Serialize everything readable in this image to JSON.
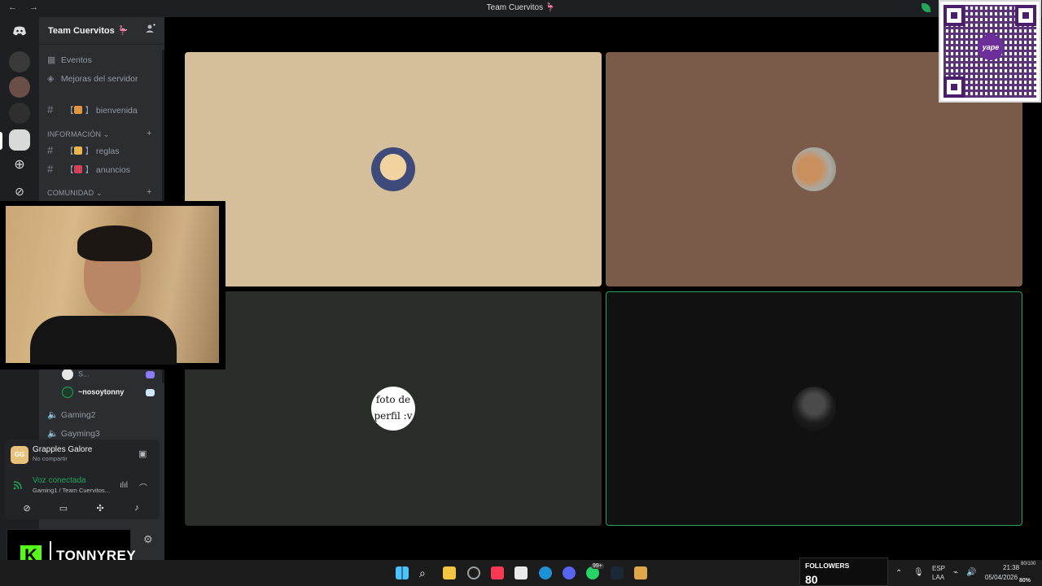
{
  "window": {
    "title": "Team Cuervitos 🦩",
    "nav_back": "←",
    "nav_forward": "→"
  },
  "server": {
    "name": "Team Cuervitos 🦩",
    "chevron": "⌄",
    "add_people_icon": "person-plus"
  },
  "channels": {
    "events": "Eventos",
    "boosts": "Mejoras del servidor",
    "welcome": "bienvenida",
    "cat_info": "INFORMACIÓN",
    "rules": "reglas",
    "announcements": "anuncios",
    "cat_community": "COMUNIDAD",
    "bracket_open": "【",
    "bracket_close": "】",
    "hash": "#",
    "plus": "+",
    "cat_chevron": "⌄"
  },
  "voice_users": [
    {
      "name": "S...",
      "status_color": "#8b7cf6"
    },
    {
      "name": "~nosoytonny",
      "status_color": "#cfe8ff"
    }
  ],
  "voice_channels": [
    "Gaming2",
    "Gayming3"
  ],
  "activity": {
    "icon_text": "GG",
    "title": "Grapples Galore",
    "subtitle": "No compartir"
  },
  "voice_status": {
    "title": "Voz conectada",
    "subtitle": "Gaming1 / Team Cuervitos..."
  },
  "tiles": [
    {
      "bg": "#d4bf9a",
      "avatar": "anime-avatar"
    },
    {
      "bg": "#7a5a48",
      "avatar": "cat-avatar"
    },
    {
      "bg": "#2b2d2b",
      "avatar": "foto-de-perfil-avatar",
      "avatar_text": "foto de perfil :v"
    },
    {
      "bg": "#111111",
      "avatar": "dark-photo-avatar",
      "speaking": true
    }
  ],
  "qr": {
    "logo_text": "yape"
  },
  "brand": {
    "letter": "K",
    "name": "TONNYREY"
  },
  "followers": {
    "label": "FOLLOWERS",
    "value": "80"
  },
  "tray": {
    "lang": "ESP",
    "layout": "LAA",
    "time": "21:38",
    "date": "05/04/2026",
    "battery": "80%",
    "battery_small": "80/100"
  },
  "taskbar_badge": "99+",
  "colors": {
    "accent_green": "#23a55a",
    "bg_dark": "#1e1f22",
    "sidebar": "#2b2d31"
  }
}
